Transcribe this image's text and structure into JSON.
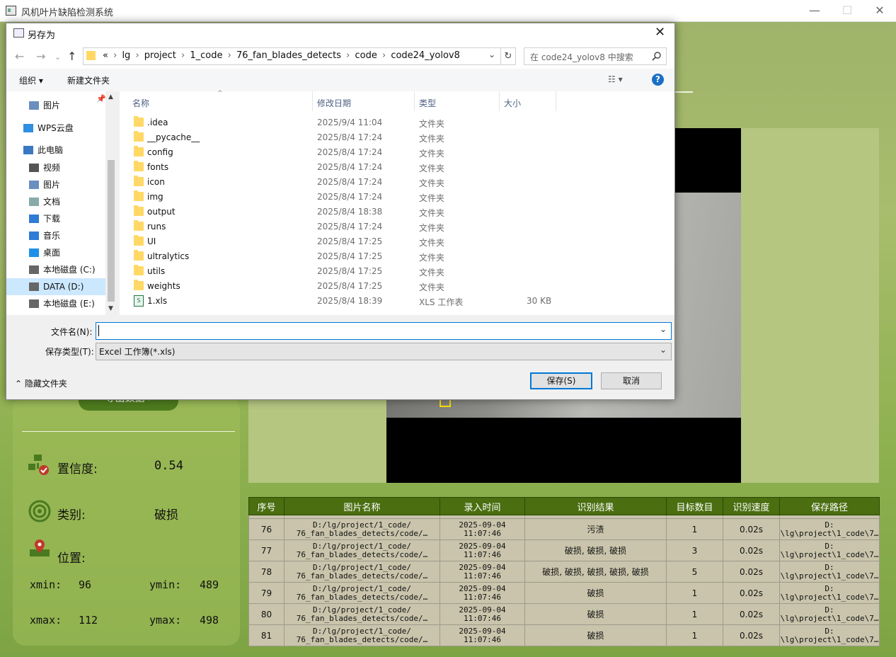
{
  "main": {
    "title": "风机叶片缺陷检测系统",
    "minimize": "—",
    "maximize": "☐",
    "close": "✕"
  },
  "left_panel": {
    "export_label": "导出数据 ›",
    "confidence_label": "置信度:",
    "confidence_value": "0.54",
    "class_label": "类别:",
    "class_value": "破损",
    "position_label": "位置:",
    "xmin_label": "xmin:",
    "xmin_value": "96",
    "ymin_label": "ymin:",
    "ymin_value": "489",
    "xmax_label": "xmax:",
    "xmax_value": "112",
    "ymax_label": "ymax:",
    "ymax_value": "498"
  },
  "table": {
    "headers": [
      "序号",
      "图片名称",
      "录入时间",
      "识别结果",
      "目标数目",
      "识别速度",
      "保存路径"
    ],
    "rows": [
      {
        "no": "76",
        "name1": "D:/lg/project/1_code/",
        "name2": "76_fan_blades_detects/code/…",
        "t1": "2025-09-04",
        "t2": "11:07:46",
        "result": "污渍",
        "count": "1",
        "speed": "0.02s",
        "p1": "D:",
        "p2": "\\lg\\project\\1_code\\7…"
      },
      {
        "no": "77",
        "name1": "D:/lg/project/1_code/",
        "name2": "76_fan_blades_detects/code/…",
        "t1": "2025-09-04",
        "t2": "11:07:46",
        "result": "破损, 破损, 破损",
        "count": "3",
        "speed": "0.02s",
        "p1": "D:",
        "p2": "\\lg\\project\\1_code\\7…"
      },
      {
        "no": "78",
        "name1": "D:/lg/project/1_code/",
        "name2": "76_fan_blades_detects/code/…",
        "t1": "2025-09-04",
        "t2": "11:07:46",
        "result": "破损, 破损, 破损, 破损, 破损",
        "count": "5",
        "speed": "0.02s",
        "p1": "D:",
        "p2": "\\lg\\project\\1_code\\7…"
      },
      {
        "no": "79",
        "name1": "D:/lg/project/1_code/",
        "name2": "76_fan_blades_detects/code/…",
        "t1": "2025-09-04",
        "t2": "11:07:46",
        "result": "破损",
        "count": "1",
        "speed": "0.02s",
        "p1": "D:",
        "p2": "\\lg\\project\\1_code\\7…"
      },
      {
        "no": "80",
        "name1": "D:/lg/project/1_code/",
        "name2": "76_fan_blades_detects/code/…",
        "t1": "2025-09-04",
        "t2": "11:07:46",
        "result": "破损",
        "count": "1",
        "speed": "0.02s",
        "p1": "D:",
        "p2": "\\lg\\project\\1_code\\7…"
      },
      {
        "no": "81",
        "name1": "D:/lg/project/1_code/",
        "name2": "76_fan_blades_detects/code/…",
        "t1": "2025-09-04",
        "t2": "11:07:46",
        "result": "破损",
        "count": "1",
        "speed": "0.02s",
        "p1": "D:",
        "p2": "\\lg\\project\\1_code\\7…"
      }
    ]
  },
  "dialog": {
    "title": "另存为",
    "address": [
      "«",
      "lg",
      "project",
      "1_code",
      "76_fan_blades_detects",
      "code",
      "code24_yolov8"
    ],
    "search_placeholder": "在 code24_yolov8 中搜索",
    "organize": "组织 ▾",
    "new_folder": "新建文件夹",
    "columns": {
      "name": "名称",
      "date": "修改日期",
      "type": "类型",
      "size": "大小"
    },
    "sidebar": [
      {
        "label": "图片",
        "icon": "pictures-icon"
      },
      {
        "label": "WPS云盘",
        "icon": "cloud-icon"
      },
      {
        "label": "此电脑",
        "icon": "computer-icon"
      },
      {
        "label": "视频",
        "icon": "video-icon"
      },
      {
        "label": "图片",
        "icon": "pictures-icon"
      },
      {
        "label": "文档",
        "icon": "document-icon"
      },
      {
        "label": "下载",
        "icon": "download-icon"
      },
      {
        "label": "音乐",
        "icon": "music-icon"
      },
      {
        "label": "桌面",
        "icon": "desktop-icon"
      },
      {
        "label": "本地磁盘 (C:)",
        "icon": "drive-icon"
      },
      {
        "label": "DATA (D:)",
        "icon": "drive-icon"
      },
      {
        "label": "本地磁盘 (E:)",
        "icon": "drive-icon"
      }
    ],
    "files": [
      {
        "name": ".idea",
        "date": "2025/9/4 11:04",
        "type": "文件夹",
        "size": ""
      },
      {
        "name": "__pycache__",
        "date": "2025/8/4 17:24",
        "type": "文件夹",
        "size": ""
      },
      {
        "name": "config",
        "date": "2025/8/4 17:24",
        "type": "文件夹",
        "size": ""
      },
      {
        "name": "fonts",
        "date": "2025/8/4 17:24",
        "type": "文件夹",
        "size": ""
      },
      {
        "name": "icon",
        "date": "2025/8/4 17:24",
        "type": "文件夹",
        "size": ""
      },
      {
        "name": "img",
        "date": "2025/8/4 17:24",
        "type": "文件夹",
        "size": ""
      },
      {
        "name": "output",
        "date": "2025/8/4 18:38",
        "type": "文件夹",
        "size": ""
      },
      {
        "name": "runs",
        "date": "2025/8/4 17:24",
        "type": "文件夹",
        "size": ""
      },
      {
        "name": "UI",
        "date": "2025/8/4 17:25",
        "type": "文件夹",
        "size": ""
      },
      {
        "name": "ultralytics",
        "date": "2025/8/4 17:25",
        "type": "文件夹",
        "size": ""
      },
      {
        "name": "utils",
        "date": "2025/8/4 17:25",
        "type": "文件夹",
        "size": ""
      },
      {
        "name": "weights",
        "date": "2025/8/4 17:25",
        "type": "文件夹",
        "size": ""
      },
      {
        "name": "1.xls",
        "date": "2025/8/4 18:39",
        "type": "XLS 工作表",
        "size": "30 KB"
      }
    ],
    "filename_label": "文件名(N):",
    "filename_value": "",
    "filetype_label": "保存类型(T):",
    "filetype_value": "Excel 工作簿(*.xls)",
    "hide_folders": "隐藏文件夹",
    "save": "保存(S)",
    "cancel": "取消"
  }
}
